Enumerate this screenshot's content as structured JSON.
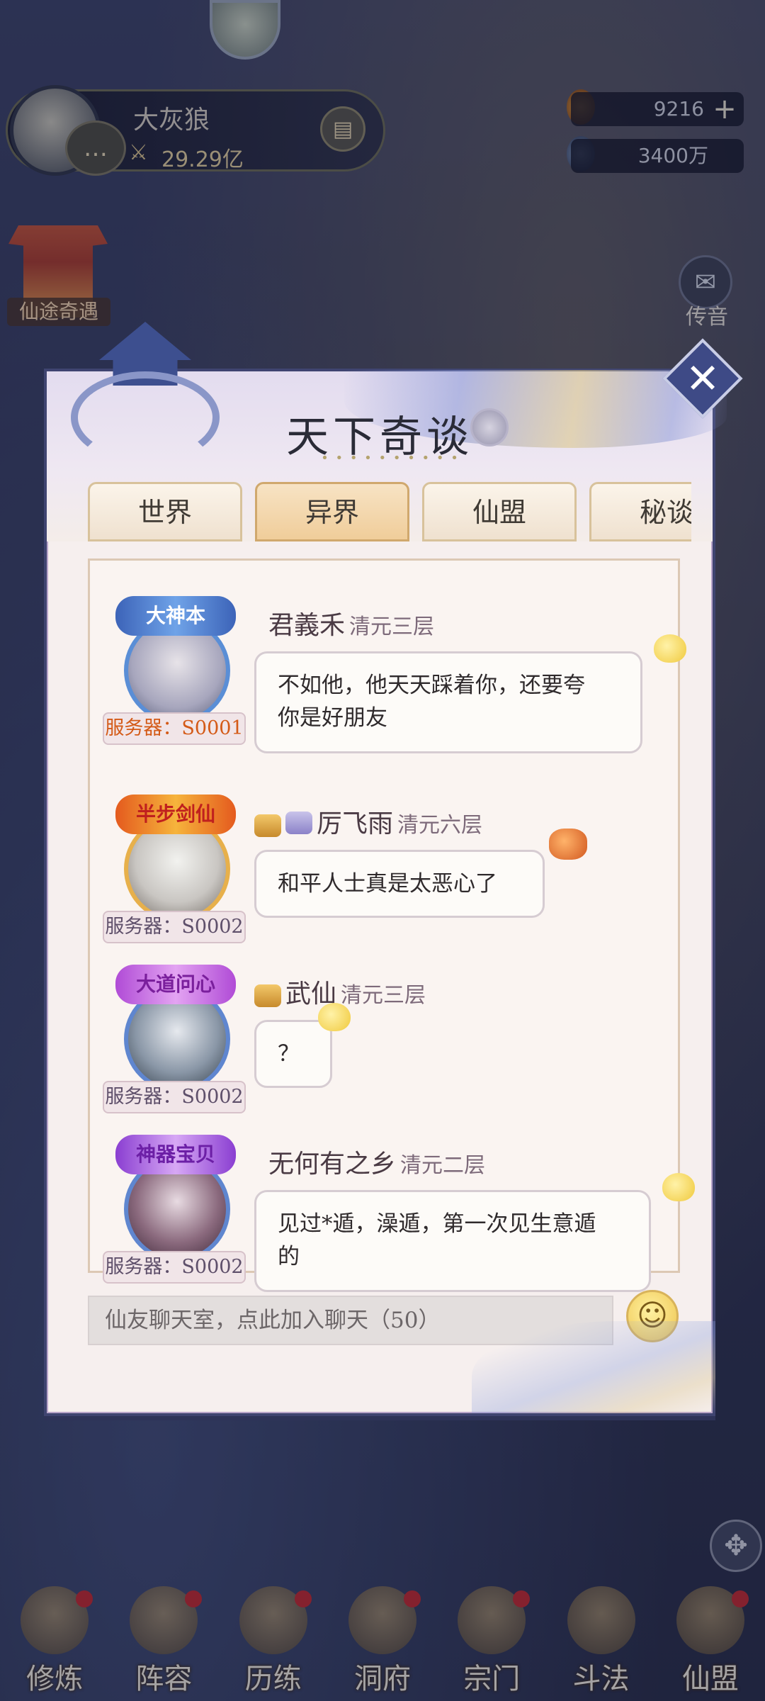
{
  "hud": {
    "player_name": "大灰狼",
    "player_power": "29.29亿",
    "currency_gems": "9216",
    "currency_coins": "3400万",
    "gem_plus": "+"
  },
  "sidebar": {
    "event_label": "仙途奇遇",
    "mail_label": "传音"
  },
  "dialog": {
    "title": "天下奇谈",
    "title_ornament": "• • • • • • • • • •",
    "close_label": "✕",
    "tabs": [
      {
        "label": "世界",
        "active": false
      },
      {
        "label": "异界",
        "active": true
      },
      {
        "label": "仙盟",
        "active": false
      },
      {
        "label": "秘谈",
        "active": false
      }
    ],
    "messages": [
      {
        "avatar_title": "大神本",
        "server": "服务器：S0001",
        "name": "君義禾",
        "level": "清元三层",
        "text_line1": "不如他，他天天踩着你，还要夸",
        "text_line2": "你是好朋友"
      },
      {
        "avatar_title": "半步剑仙",
        "server": "服务器：S0002",
        "name": "厉飞雨",
        "level": "清元六层",
        "text_line1": "和平人士真是太恶心了",
        "text_line2": ""
      },
      {
        "avatar_title": "大道问心",
        "server": "服务器：S0002",
        "name": "武仙",
        "level": "清元三层",
        "text_line1": "？",
        "text_line2": ""
      },
      {
        "avatar_title": "神器宝贝",
        "server": "服务器：S0002",
        "name": "无何有之乡",
        "level": "清元二层",
        "text_line1": "见过*遁，澡遁，第一次见生意遁",
        "text_line2": "的"
      }
    ],
    "input_placeholder": "仙友聊天室，点此加入聊天（50）"
  },
  "bottom_nav": [
    {
      "label": "修炼"
    },
    {
      "label": "阵容"
    },
    {
      "label": "历练"
    },
    {
      "label": "洞府"
    },
    {
      "label": "宗门"
    },
    {
      "label": "斗法"
    },
    {
      "label": "仙盟"
    }
  ],
  "colors": {
    "dialog_border": "#3f4470",
    "tab_active": "#f0cd9a",
    "server_orange": "#d45a17",
    "notification_dot": "#c0272d"
  }
}
